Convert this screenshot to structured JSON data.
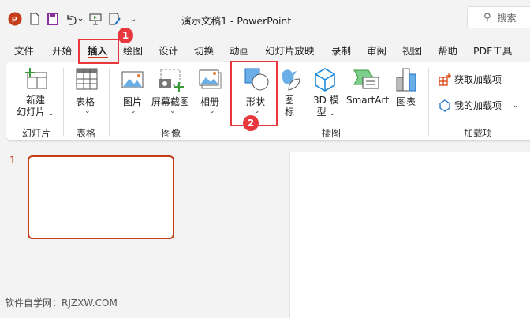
{
  "title_bar": {
    "doc_title": "演示文稿1  -  PowerPoint",
    "search_placeholder": "搜索"
  },
  "tabs": [
    "文件",
    "开始",
    "插入",
    "绘图",
    "设计",
    "切换",
    "动画",
    "幻灯片放映",
    "录制",
    "审阅",
    "视图",
    "帮助",
    "PDF工具"
  ],
  "active_tab": "插入",
  "ribbon": {
    "new_slide": [
      "新建",
      "幻灯片"
    ],
    "table": "表格",
    "picture": "图片",
    "screenshot": "屏幕截图",
    "album": "相册",
    "shapes": "形状",
    "icons": [
      "图",
      "标"
    ],
    "model3d": [
      "3D 模",
      "型"
    ],
    "smartart": "SmartArt",
    "chart": "图表",
    "get_addins": "获取加载项",
    "my_addins": "我的加载项",
    "groups": {
      "slides": "幻灯片",
      "tables": "表格",
      "images": "图像",
      "illustrations": "插图",
      "addins": "加载项"
    }
  },
  "annotations": {
    "badge1": "1",
    "badge2": "2"
  },
  "thumbnail_number": "1",
  "watermark": "软件自学网：RJZXW.COM",
  "colors": {
    "accent": "#c43e1c",
    "annotation": "#e8383d"
  }
}
